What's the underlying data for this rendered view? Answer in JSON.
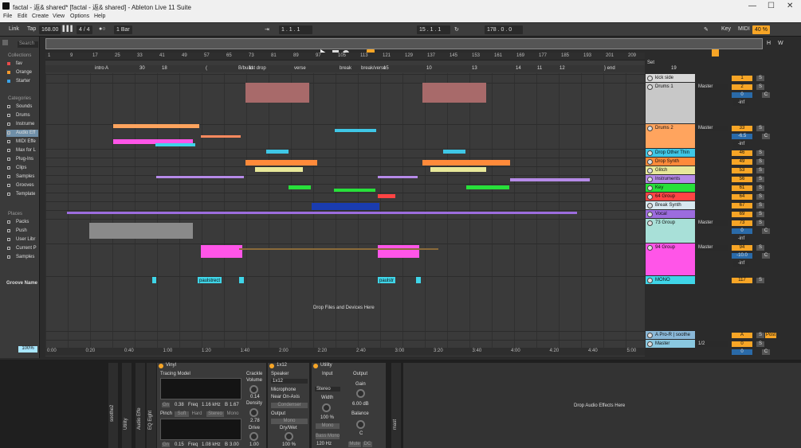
{
  "window": {
    "title": "factal - 返& shared* [factal - 返& shared] - Ableton Live 11 Suite"
  },
  "menu": [
    "File",
    "Edit",
    "Create",
    "View",
    "Options",
    "Help"
  ],
  "transport": {
    "link": "Link",
    "tap": "Tap",
    "tempo": "168.00",
    "sig": "4 / 4",
    "quant": "1 Bar",
    "pos": "1 . 1 . 1",
    "loop_start": "15 . 1 . 1",
    "loop_len": "178 . 0 . 0",
    "key": "Key",
    "midi": "MIDI",
    "cpu": "40 %",
    "hw": "H",
    "w": "W"
  },
  "browser": {
    "search": "Search",
    "collections_head": "Collections",
    "collections": [
      "fav",
      "Orange",
      "Starter"
    ],
    "collection_colors": [
      "#e84b4b",
      "#f39a2d",
      "#3aa3e8"
    ],
    "categories_head": "Categories",
    "categories": [
      "Sounds",
      "Drums",
      "Instrume",
      "Audio Eff",
      "MIDI Effe",
      "Max for L",
      "Plug-Ins",
      "Clips",
      "Samples",
      "Grooves",
      "Template"
    ],
    "places_head": "Places",
    "places": [
      "Packs",
      "Push",
      "User Libr",
      "Current P",
      "Samples"
    ],
    "groove": "Groove Name",
    "zoom": "100%"
  },
  "ruler": [
    "1",
    "9",
    "17",
    "25",
    "33",
    "41",
    "49",
    "57",
    "65",
    "73",
    "81",
    "89",
    "97",
    "105",
    "113",
    "121",
    "129",
    "137",
    "145",
    "153",
    "161",
    "169",
    "177",
    "185",
    "193",
    "201",
    "209"
  ],
  "locators": [
    "intro",
    "A",
    "30",
    "18",
    "(",
    "B/build",
    "1st drop",
    "verse",
    "break",
    "break/verse",
    "15",
    "10",
    "13",
    "14",
    "11",
    "12",
    "} end",
    "19"
  ],
  "time": [
    "0:00",
    "0:20",
    "0:40",
    "1:00",
    "1:20",
    "1:40",
    "2:00",
    "2:20",
    "2:40",
    "3:00",
    "3:20",
    "3:40",
    "4:00",
    "4:20",
    "4:40",
    "5:00"
  ],
  "drop_files": "Drop Files and Devices Here",
  "clip_labels": [
    "paulstrect",
    "paulstr"
  ],
  "set": "Set",
  "tracks": [
    {
      "name": "kick side",
      "color": "#d9d9d9",
      "route": "",
      "vol": "1"
    },
    {
      "name": "Drums 1",
      "color": "#c8c8c8",
      "route": "Master",
      "vol": "2",
      "pan": "0",
      "sub": "-inf"
    },
    {
      "name": "Drums 2",
      "color": "#ffa45e",
      "route": "Master",
      "vol": "33",
      "pan": "-6.5",
      "sub": "-inf"
    },
    {
      "name": "Drop Other Thin",
      "color": "#3fc7e6",
      "vol": "46"
    },
    {
      "name": "Drop Synth",
      "color": "#ff8a3a",
      "vol": "49"
    },
    {
      "name": "Glitch",
      "color": "#e8e89a",
      "vol": "53"
    },
    {
      "name": "Instruments",
      "color": "#b68ae8",
      "vol": "56"
    },
    {
      "name": "Key",
      "color": "#27e03a",
      "vol": "61"
    },
    {
      "name": "64 Group",
      "color": "#ff4444",
      "vol": "64"
    },
    {
      "name": "Break Synth",
      "color": "#d8e8f0",
      "vol": "67"
    },
    {
      "name": "Vocal",
      "color": "#9c6cde",
      "vol": "69"
    },
    {
      "name": "73 Group",
      "color": "#a8e0d8",
      "route": "Master",
      "vol": "73",
      "pan": "0",
      "sub": "-inf"
    },
    {
      "name": "94 Group",
      "color": "#ff55e8",
      "route": "Master",
      "vol": "94",
      "pan": "-10.0",
      "sub": "-inf"
    },
    {
      "name": "MONO",
      "color": "#3fd5e8",
      "vol": "117"
    },
    {
      "name": "A Pro-R | soothe",
      "color": "#8ab8d8",
      "vol": "A",
      "post": "Post"
    },
    {
      "name": "Master",
      "color": "#8ac8e0",
      "route": "1/2",
      "vol": "0",
      "pan": "0"
    }
  ],
  "devices": {
    "vinyl": {
      "title": "Vinyl",
      "tracing": "Tracing Model",
      "crackle": "Crackle",
      "volume": "Volume",
      "vol_val": "0.14",
      "density": "Density",
      "dens_val": "2.78",
      "drive": "Drive",
      "drive_val": "1.00",
      "g1": "0.38",
      "f1": "1.16 kHz",
      "b1": "1.67",
      "pinch": "Pinch",
      "soft": "Soft",
      "hard": "Hard",
      "stereo": "Stereo",
      "mono": "Mono",
      "g2": "0.15",
      "f2": "1.08 kHz",
      "b2": "3.00",
      "gain": "Gn",
      "freq": "Freq",
      "bw": "B"
    },
    "cab": {
      "title": "1x12",
      "speaker": "Speaker",
      "speaker_val": "1x12",
      "mic": "Microphone",
      "mic_val": "Near On-Axis",
      "cond": "Condenser",
      "output": "Output",
      "out_mono": "Mono",
      "drywet": "Dry/Wet",
      "dw_val": "100 %"
    },
    "utility": {
      "title": "Utility",
      "input": "Input",
      "output": "Output",
      "stereo": "Stereo",
      "gain": "Gain",
      "gain_val": "6.00 dB",
      "width": "Width",
      "width_val": "100 %",
      "balance": "Balance",
      "bal_val": "C",
      "mono": "Mono",
      "bass": "Bass Mono",
      "hz": "120 Hz",
      "mute": "Mute",
      "dc": "DC"
    },
    "side_labels": [
      "soothe2",
      "Utility",
      "Audio Effe",
      "EQ Eight",
      "mast"
    ],
    "drop_effects": "Drop Audio Effects Here"
  },
  "colors": {
    "accent": "#f7a526",
    "selected": "#a8e6ff"
  }
}
